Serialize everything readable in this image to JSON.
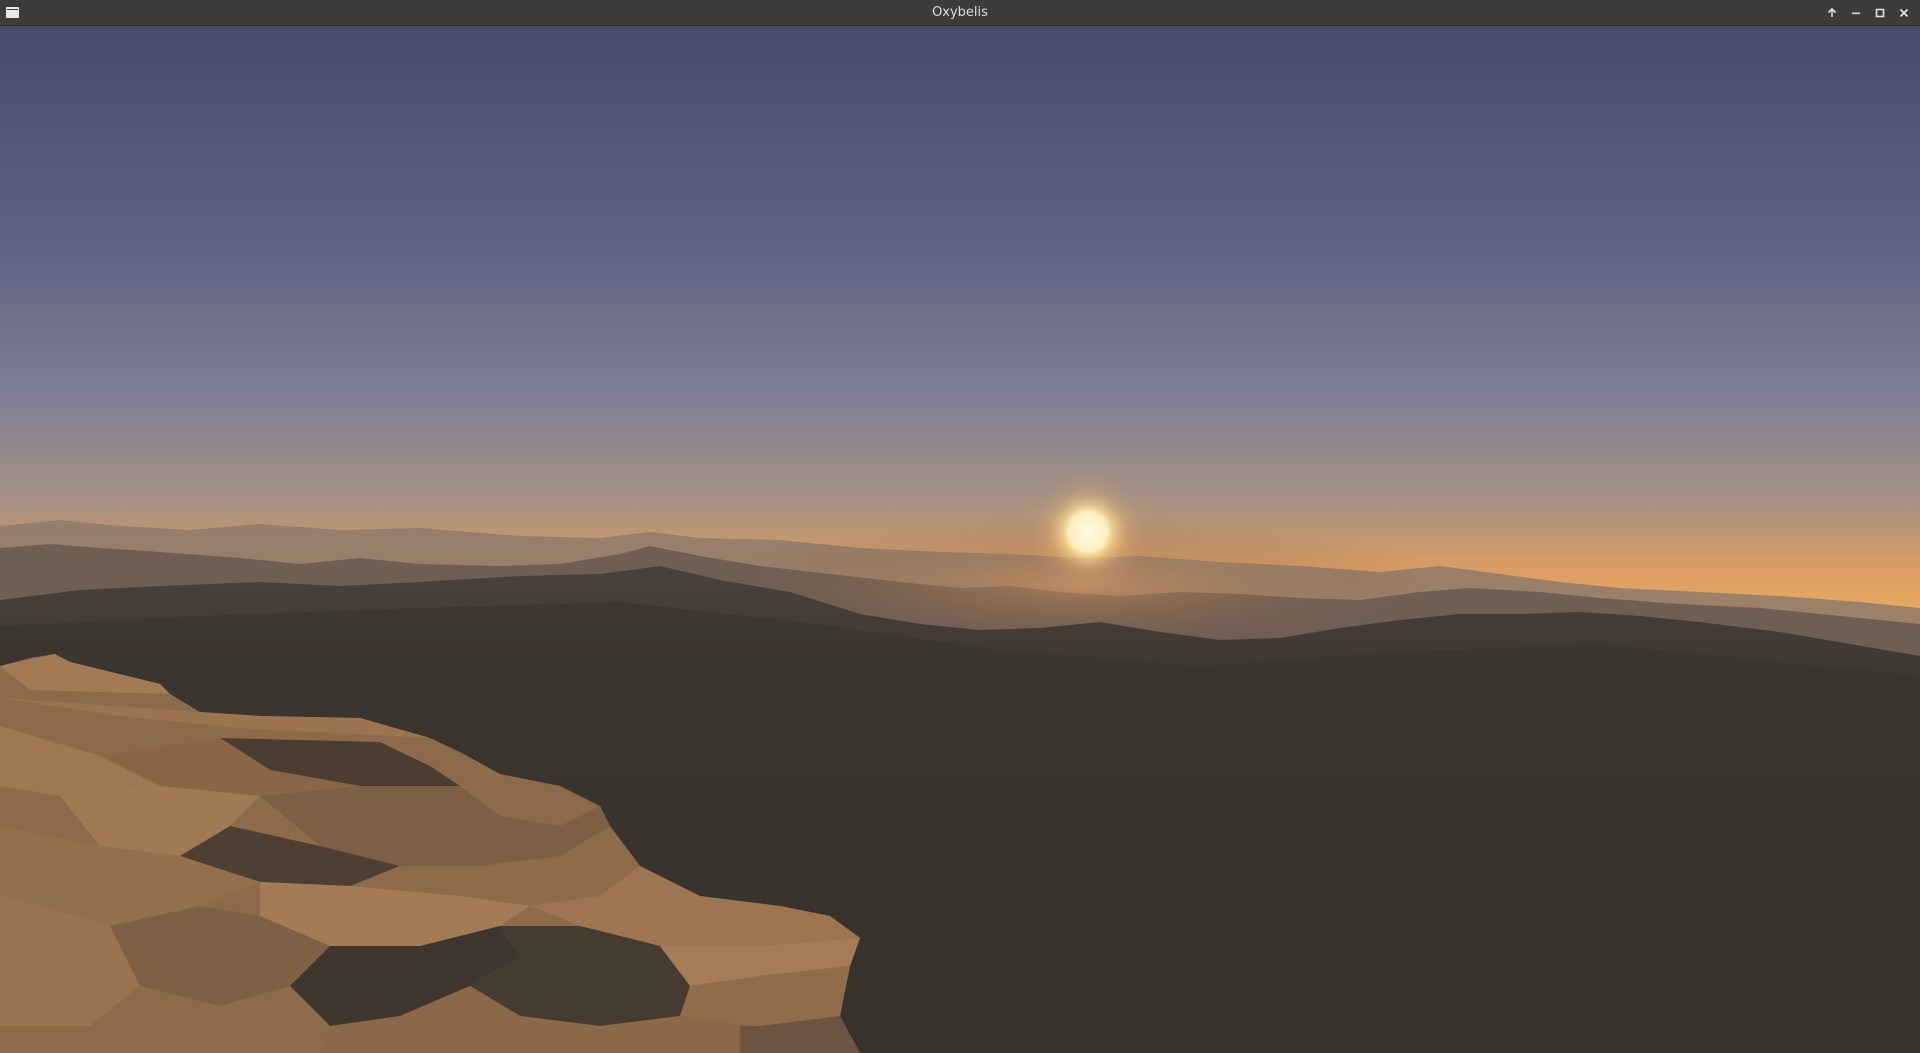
{
  "window": {
    "title": "Oxybelis",
    "icons": {
      "app": "window-menu-icon",
      "keep_above": "arrow-up-icon",
      "minimize": "minimize-icon",
      "maximize": "maximize-icon",
      "close": "close-icon"
    }
  },
  "scene": {
    "sky_top": "#4a506a",
    "sky_mid": "#7e7f98",
    "horizon_glow": "#e6a062",
    "sun_color": "#fff2cc",
    "terrain_near": "#9c7550",
    "terrain_far": "#3a352f"
  }
}
